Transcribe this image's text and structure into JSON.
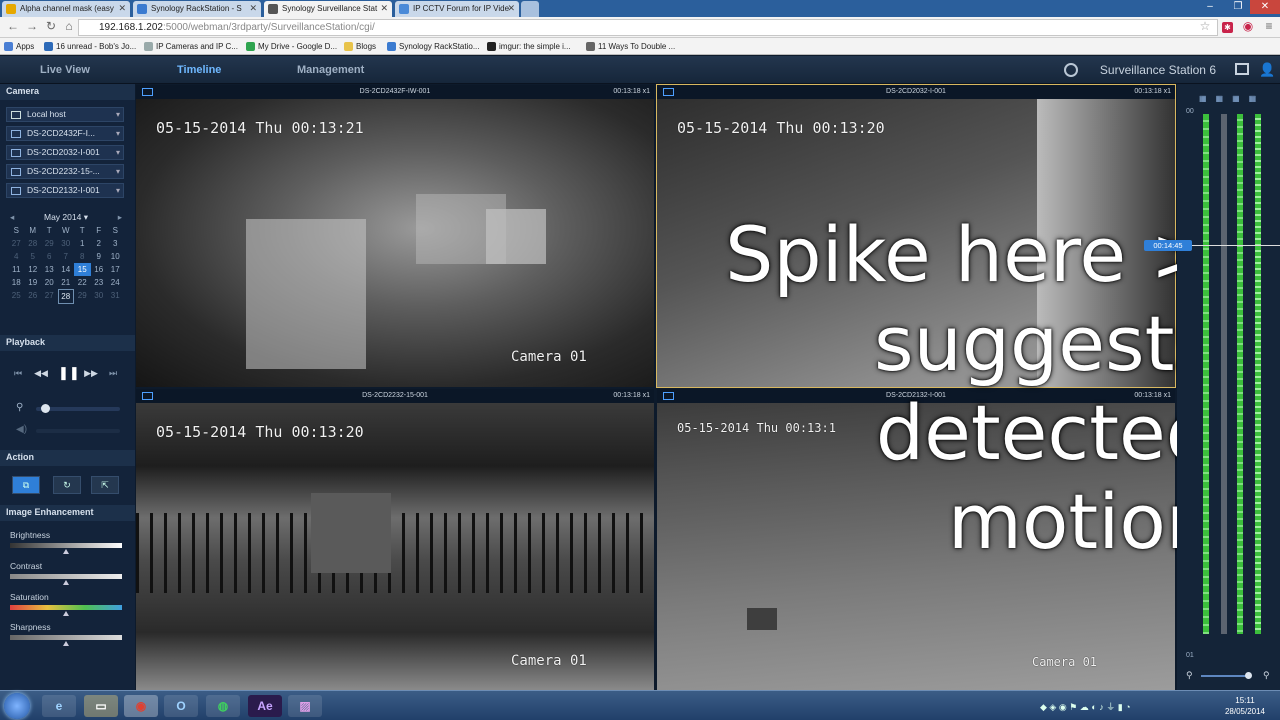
{
  "browser": {
    "tabs": [
      {
        "label": "Alpha channel mask (easy"
      },
      {
        "label": "Synology RackStation - S"
      },
      {
        "label": "Synology Surveillance Stat"
      },
      {
        "label": "IP CCTV Forum for IP Vide"
      }
    ],
    "url_main": "192.168.1.202",
    "url_rest": ":5000/webman/3rdparty/SurveillanceStation/cgi/",
    "bookmarks": [
      "Apps",
      "16 unread - Bob's Jo...",
      "IP Cameras and IP C...",
      "My Drive - Google D...",
      "Blogs",
      "Synology RackStatio...",
      "imgur: the simple i...",
      "11 Ways To Double ..."
    ]
  },
  "app": {
    "tabs": [
      "Live View",
      "Timeline",
      "Management"
    ],
    "title": "Surveillance Station 6"
  },
  "sidebar": {
    "camera_header": "Camera",
    "host": "Local host",
    "cameras": [
      "DS-2CD2432F-I...",
      "DS-2CD2032-I-001",
      "DS-2CD2232-15-...",
      "DS-2CD2132-I-001"
    ],
    "calendar": {
      "month": "May 2014",
      "weekdays": [
        "S",
        "M",
        "T",
        "W",
        "T",
        "F",
        "S"
      ],
      "days": [
        [
          "27",
          "28",
          "29",
          "30",
          "1",
          "2",
          "3"
        ],
        [
          "4",
          "5",
          "6",
          "7",
          "8",
          "9",
          "10"
        ],
        [
          "11",
          "12",
          "13",
          "14",
          "15",
          "16",
          "17"
        ],
        [
          "18",
          "19",
          "20",
          "21",
          "22",
          "23",
          "24"
        ],
        [
          "25",
          "26",
          "27",
          "28",
          "29",
          "30",
          "31"
        ]
      ],
      "selected": "15"
    },
    "playback_header": "Playback",
    "action_header": "Action",
    "enhance_header": "Image Enhancement",
    "enhance": [
      {
        "label": "Brightness",
        "level": 0.5
      },
      {
        "label": "Contrast",
        "level": 0.5
      },
      {
        "label": "Saturation",
        "level": 0.5
      },
      {
        "label": "Sharpness",
        "level": 0.5
      }
    ]
  },
  "panes": [
    {
      "name": "DS-2CD2432F-IW-001",
      "time": "00:13:18 x1",
      "osd_date": "05-15-2014 Thu 00:13:21",
      "osd_cam": "Camera 01"
    },
    {
      "name": "DS-2CD2032-I-001",
      "time": "00:13:18 x1",
      "osd_date": "05-15-2014 Thu 00:13:20",
      "osd_cam": ""
    },
    {
      "name": "DS-2CD2232-15-001",
      "time": "00:13:18 x1",
      "osd_date": "05-15-2014 Thu 00:13:20",
      "osd_cam": "Camera 01"
    },
    {
      "name": "DS-2CD2132-I-001",
      "time": "00:13:18 x1",
      "osd_date": "05-15-2014 Thu 00:13:1",
      "osd_cam": "Camera 01"
    }
  ],
  "overlay": {
    "line1": "Spike here >",
    "line2": "suggests",
    "line3": "detected",
    "line4": "motion"
  },
  "timeline": {
    "marker": "00:14:45",
    "top_label": "00",
    "bottom_label": "01"
  },
  "taskbar": {
    "time": "15:11",
    "date": "28/05/2014"
  }
}
